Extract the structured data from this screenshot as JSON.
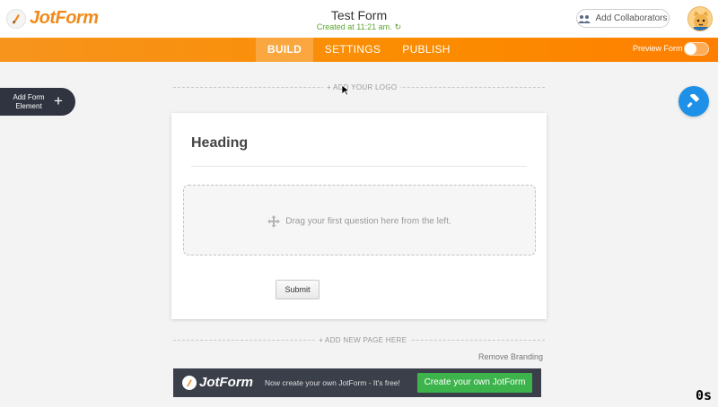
{
  "header": {
    "logo_text": "JotForm",
    "form_title": "Test Form",
    "form_subtitle": "Created at 11:21 am.",
    "collaborators_label": "Add Collaborators"
  },
  "nav": {
    "tabs": [
      {
        "label": "BUILD",
        "active": true
      },
      {
        "label": "SETTINGS",
        "active": false
      },
      {
        "label": "PUBLISH",
        "active": false
      }
    ],
    "preview_label": "Preview Form",
    "preview_enabled": false
  },
  "sidebar": {
    "add_element_label": "Add Form Element",
    "add_element_icon": "plus-icon"
  },
  "canvas": {
    "add_logo_label": "+ ADD YOUR LOGO",
    "heading": "Heading",
    "dropzone_text": "Drag your first question here from the left.",
    "submit_label": "Submit",
    "add_page_label": "+ ADD NEW PAGE HERE",
    "remove_branding_label": "Remove Branding"
  },
  "branding_bar": {
    "logo_text": "JotForm",
    "message": "Now create your own JotForm - It's free!",
    "cta_label": "Create your own JotForm"
  },
  "overlay": {
    "corner_text": "0s"
  },
  "colors": {
    "brand_orange": "#f7941d",
    "accent_blue": "#1e90e8",
    "cta_green": "#3cb44b",
    "dark_bar": "#3b3f4a",
    "subtitle_green": "#5aa52f"
  }
}
